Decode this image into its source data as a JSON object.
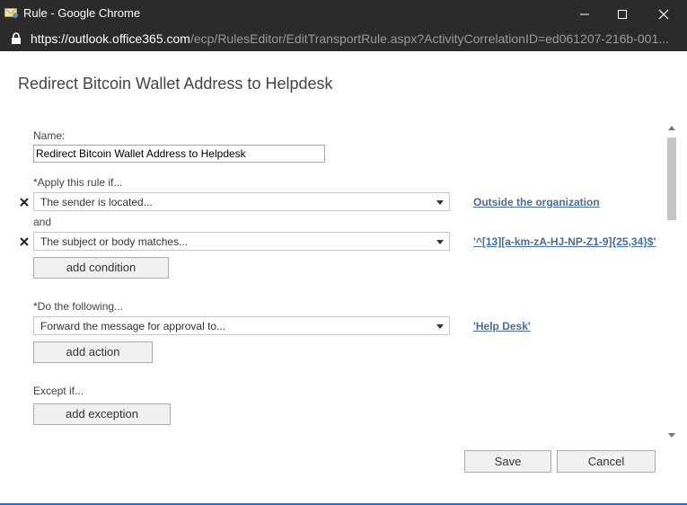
{
  "window": {
    "title": "Rule - Google Chrome",
    "url_host": "https://outlook.office365.com",
    "url_path": "/ecp/RulesEditor/EditTransportRule.aspx?ActivityCorrelationID=ed061207-216b-001..."
  },
  "page": {
    "title": "Redirect Bitcoin Wallet Address to Helpdesk"
  },
  "form": {
    "name_label": "Name:",
    "name_value": "Redirect Bitcoin Wallet Address to Helpdesk",
    "apply_label": "*Apply this rule if...",
    "condition1": {
      "value": "The sender is located...",
      "link": "Outside the organization"
    },
    "and_label": "and",
    "condition2": {
      "value": "The subject or body matches...",
      "link": "'^[13][a-km-zA-HJ-NP-Z1-9]{25,34}$'"
    },
    "add_condition_label": "add condition",
    "do_label": "*Do the following...",
    "action1": {
      "value": "Forward the message for approval to...",
      "link": "'Help Desk'"
    },
    "add_action_label": "add action",
    "except_label": "Except if...",
    "add_exception_label": "add exception"
  },
  "footer": {
    "save_label": "Save",
    "cancel_label": "Cancel"
  },
  "colors": {
    "titlebar": "#2b2b2b",
    "link": "#4a6d93",
    "accent": "#1e6ec8"
  }
}
